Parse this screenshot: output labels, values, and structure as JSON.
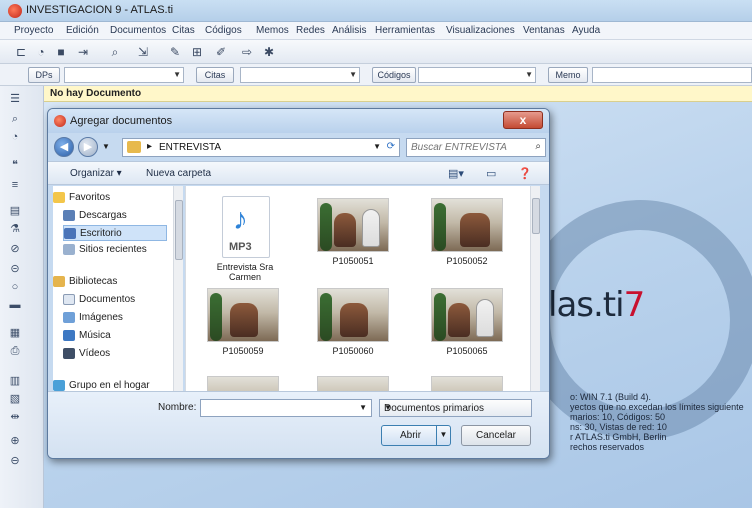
{
  "window": {
    "title": "INVESTIGACION 9 - ATLAS.ti"
  },
  "menubar": {
    "items": [
      "Proyecto",
      "Edición",
      "Documentos",
      "Citas",
      "Códigos",
      "Memos",
      "Redes",
      "Análisis",
      "Herramientas",
      "Visualizaciones",
      "Ventanas",
      "Ayuda"
    ]
  },
  "toolbar": {
    "icons": [
      "new-doc-icon",
      "comment-icon",
      "save-icon",
      "add-icon",
      "search-binoculars-icon",
      "import-icon",
      "code-icon",
      "network-icon",
      "pencil-icon",
      "arrow-icon",
      "settings-icon"
    ]
  },
  "selectors": {
    "docs_label": "DPs",
    "quotes_label": "Citas",
    "codes_label": "Códigos",
    "memo_label": "Memo"
  },
  "host": {
    "status": "No hay Documento"
  },
  "logo": {
    "text": "las.ti",
    "seven": "7"
  },
  "info": {
    "lines": [
      "o: WIN 7.1 (Build 4).",
      "yectos que no excedan los límites siguiente",
      "marios: 10, Códigos: 50",
      "ns: 30, Vistas de red: 10",
      "r ATLAS.ti GmbH, Berlin",
      "rechos reservados"
    ]
  },
  "dialog": {
    "title": "Agregar documentos",
    "close": "x",
    "path": "ENTREVISTA",
    "search_placeholder": "Buscar ENTREVISTA",
    "organize": "Organizar ▾",
    "new_folder": "Nueva carpeta",
    "nav": [
      {
        "label": "Favoritos",
        "color": "#f3c64a"
      },
      {
        "label": "Descargas",
        "color": "#5a7fb6"
      },
      {
        "label": "Escritorio",
        "color": "#4a74b8"
      },
      {
        "label": "Sitios recientes",
        "color": "#9ab1cf"
      },
      {
        "label": "Bibliotecas",
        "color": "#e5b44d"
      },
      {
        "label": "Documentos",
        "color": "#dfe7f2"
      },
      {
        "label": "Imágenes",
        "color": "#6fa0d8"
      },
      {
        "label": "Música",
        "color": "#3d78c3"
      },
      {
        "label": "Vídeos",
        "color": "#3e4e66"
      },
      {
        "label": "Grupo en el hogar",
        "color": "#4aa0d8"
      }
    ],
    "files": [
      {
        "name": "Entrevista Sra Carmen",
        "type": "mp3",
        "type_label": "MP3"
      },
      {
        "name": "P1050051",
        "type": "photo"
      },
      {
        "name": "P1050052",
        "type": "photo"
      },
      {
        "name": "P1050059",
        "type": "photo"
      },
      {
        "name": "P1050060",
        "type": "photo"
      },
      {
        "name": "P1050065",
        "type": "photo"
      }
    ],
    "filename_label": "Nombre:",
    "filename_value": "",
    "filetype": "Documentos primarios",
    "open_label": "Abrir",
    "cancel_label": "Cancelar"
  }
}
